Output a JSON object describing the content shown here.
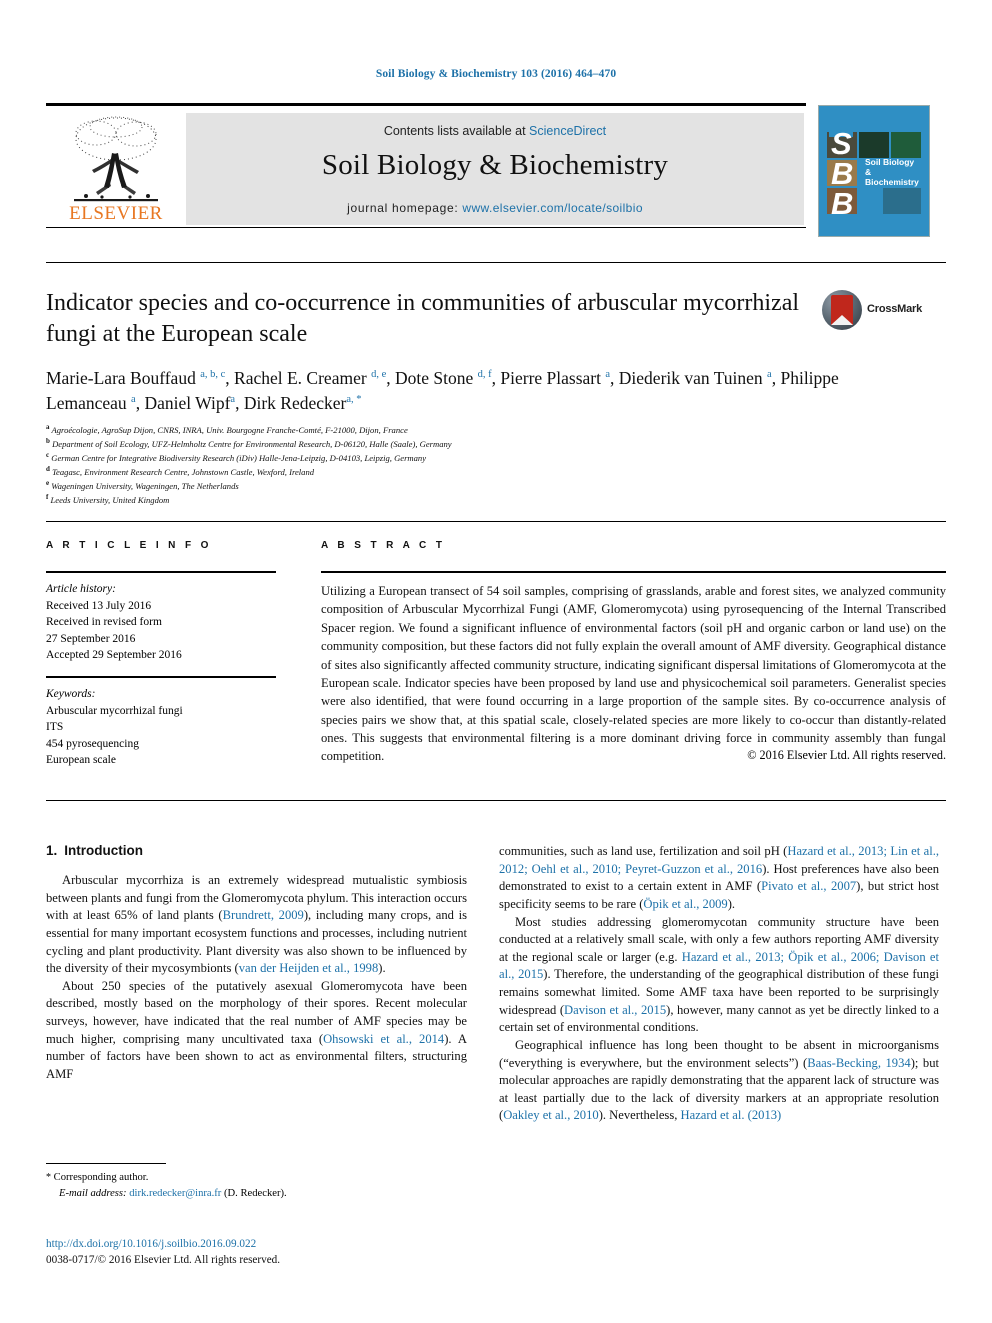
{
  "running_head": "Soil Biology & Biochemistry 103 (2016) 464–470",
  "masthead": {
    "contents_prefix": "Contents lists available at ",
    "sciencedirect": "ScienceDirect",
    "journal_title": "Soil Biology & Biochemistry",
    "homepage_label": "journal homepage: ",
    "homepage_url": "www.elsevier.com/locate/soilbio",
    "publisher": "ELSEVIER",
    "cover": {
      "letters": [
        "S",
        "B",
        "B"
      ],
      "title": "Soil Biology & Biochemistry",
      "accent_color": "#2f8fc4"
    }
  },
  "article": {
    "title": "Indicator species and co-occurrence in communities of arbuscular mycorrhizal fungi at the European scale",
    "crossmark_label": "CrossMark",
    "authors_html": "Marie-Lara Bouffaud <sup class=\"aff\">a, b, c</sup>, Rachel E. Creamer <sup class=\"aff\">d, e</sup>, Dote Stone <sup class=\"aff\">d, f</sup>, Pierre Plassart <sup class=\"aff\">a</sup>, Diederik van Tuinen <sup class=\"aff\">a</sup>, Philippe Lemanceau <sup class=\"aff\">a</sup>, Daniel Wipf<sup class=\"aff\">a</sup>, Dirk Redecker<sup class=\"aff\">a, *</sup>",
    "affiliations": [
      {
        "key": "a",
        "text": "Agroécologie, AgroSup Dijon, CNRS, INRA, Univ. Bourgogne Franche-Comté, F-21000, Dijon, France"
      },
      {
        "key": "b",
        "text": "Department of Soil Ecology, UFZ-Helmholtz Centre for Environmental Research, D-06120, Halle (Saale), Germany"
      },
      {
        "key": "c",
        "text": "German Centre for Integrative Biodiversity Research (iDiv) Halle-Jena-Leipzig, D-04103, Leipzig, Germany"
      },
      {
        "key": "d",
        "text": "Teagasc, Environment Research Centre, Johnstown Castle, Wexford, Ireland"
      },
      {
        "key": "e",
        "text": "Wageningen University, Wageningen, The Netherlands"
      },
      {
        "key": "f",
        "text": "Leeds University, United Kingdom"
      }
    ]
  },
  "info": {
    "heading": "A R T I C L E  I N F O",
    "history_label": "Article history:",
    "history": [
      "Received 13 July 2016",
      "Received in revised form",
      "27 September 2016",
      "Accepted 29 September 2016"
    ],
    "keywords_label": "Keywords:",
    "keywords": [
      "Arbuscular mycorrhizal fungi",
      "ITS",
      "454 pyrosequencing",
      "European scale"
    ]
  },
  "abstract": {
    "heading": "A B S T R A C T",
    "text": "Utilizing a European transect of 54 soil samples, comprising of grasslands, arable and forest sites, we analyzed community composition of Arbuscular Mycorrhizal Fungi (AMF, Glomeromycota) using pyrosequencing of the Internal Transcribed Spacer region. We found a significant influence of environmental factors (soil pH and organic carbon or land use) on the community composition, but these factors did not fully explain the overall amount of AMF diversity. Geographical distance of sites also significantly affected community structure, indicating significant dispersal limitations of Glomeromycota at the European scale. Indicator species have been proposed by land use and physicochemical soil parameters. Generalist species were also identified, that were found occurring in a large proportion of the sample sites. By co-occurrence analysis of species pairs we show that, at this spatial scale, closely-related species are more likely to co-occur than distantly-related ones. This suggests that environmental filtering is a more dominant driving force in community assembly than fungal competition.",
    "copyright": "© 2016 Elsevier Ltd. All rights reserved."
  },
  "body": {
    "section_number": "1.",
    "section_title": "Introduction",
    "left_paragraphs_html": [
      "Arbuscular mycorrhiza is an extremely widespread mutualistic symbiosis between plants and fungi from the Glomeromycota phylum. This interaction occurs with at least 65% of land plants (<span class=\"ref\">Brundrett, 2009</span>), including many crops, and is essential for many important ecosystem functions and processes, including nutrient cycling and plant productivity. Plant diversity was also shown to be influenced by the diversity of their mycosymbionts (<span class=\"ref\">van der Heijden et al., 1998</span>).",
      "About 250 species of the putatively asexual Glomeromycota have been described, mostly based on the morphology of their spores. Recent molecular surveys, however, have indicated that the real number of AMF species may be much higher, comprising many uncultivated taxa (<span class=\"ref\">Ohsowski et al., 2014</span>). A number of factors have been shown to act as environmental filters, structuring AMF"
    ],
    "right_paragraphs_html": [
      "communities, such as land use, fertilization and soil pH (<span class=\"ref\">Hazard et al., 2013; Lin et al., 2012; Oehl et al., 2010; Peyret-Guzzon et al., 2016</span>). Host preferences have also been demonstrated to exist to a certain extent in AMF (<span class=\"ref\">Pivato et al., 2007</span>), but strict host specificity seems to be rare (<span class=\"ref\">Öpik et al., 2009</span>).",
      "Most studies addressing glomeromycotan community structure have been conducted at a relatively small scale, with only a few authors reporting AMF diversity at the regional scale or larger (e.g. <span class=\"ref\">Hazard et al., 2013; Öpik et al., 2006; Davison et al., 2015</span>). Therefore, the understanding of the geographical distribution of these fungi remains somewhat limited. Some AMF taxa have been reported to be surprisingly widespread (<span class=\"ref\">Davison et al., 2015</span>), however, many cannot as yet be directly linked to a certain set of environmental conditions.",
      "Geographical influence has long been thought to be absent in microorganisms (“everything is everywhere, but the environment selects”) (<span class=\"ref\">Baas-Becking, 1934</span>); but molecular approaches are rapidly demonstrating that the apparent lack of structure was at least partially due to the lack of diversity markers at an appropriate resolution (<span class=\"ref\">Oakley et al., 2010</span>). Nevertheless, <span class=\"ref\">Hazard et al. (2013)</span>"
    ]
  },
  "footer": {
    "corresponding_marker": "*",
    "corresponding_text": "Corresponding author.",
    "email_label": "E-mail address:",
    "email": "dirk.redecker@inra.fr",
    "email_owner": "(D. Redecker).",
    "doi": "http://dx.doi.org/10.1016/j.soilbio.2016.09.022",
    "issn_line": "0038-0717/© 2016 Elsevier Ltd. All rights reserved."
  },
  "colors": {
    "link": "#1d71a8",
    "elsevier_orange": "#e87722",
    "banner_gray": "#e3e3e3"
  }
}
